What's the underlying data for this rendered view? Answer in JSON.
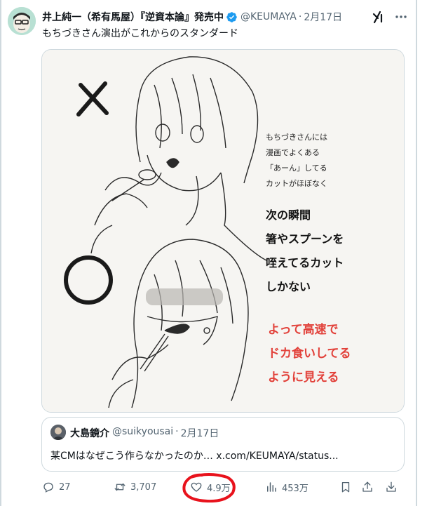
{
  "author": {
    "name": "井上純一（希有馬屋）『逆資本論』発売中",
    "handle": "@KEUMAYA",
    "separator": "·",
    "date": "2月17日"
  },
  "tweet": {
    "text": "もちづきさん演出がこれからのスタンダード"
  },
  "image_text": {
    "lines_intro": [
      "もちづきさんには",
      "漫画でよくある",
      "「あーん」してる",
      "カットがほぼなく"
    ],
    "lines_bold": [
      "次の瞬間",
      "箸やスプーンを",
      "咥えてるカット",
      "しかない"
    ],
    "lines_red": [
      "よって高速で",
      "ドカ食いしてる",
      "ように見える"
    ]
  },
  "quote": {
    "name": "大島鏡介",
    "handle": "@suikyousai",
    "separator": "·",
    "date": "2月17日",
    "text": "某CMはなぜこう作らなかったのか… x.com/KEUMAYA/status..."
  },
  "actions": {
    "replies": "27",
    "reposts": "3,707",
    "likes": "4.9万",
    "views": "453万"
  },
  "colors": {
    "text": "#0f1419",
    "secondary": "#536471",
    "border": "#cfd9de",
    "verified": "#1d9bf0",
    "annotation_red": "#e2413a",
    "highlight_circle": "#e8121c"
  },
  "icons": [
    "verified-badge-icon",
    "grok-icon",
    "more-icon",
    "reply-icon",
    "repost-icon",
    "like-icon",
    "views-icon",
    "bookmark-icon",
    "share-icon",
    "download-icon"
  ]
}
